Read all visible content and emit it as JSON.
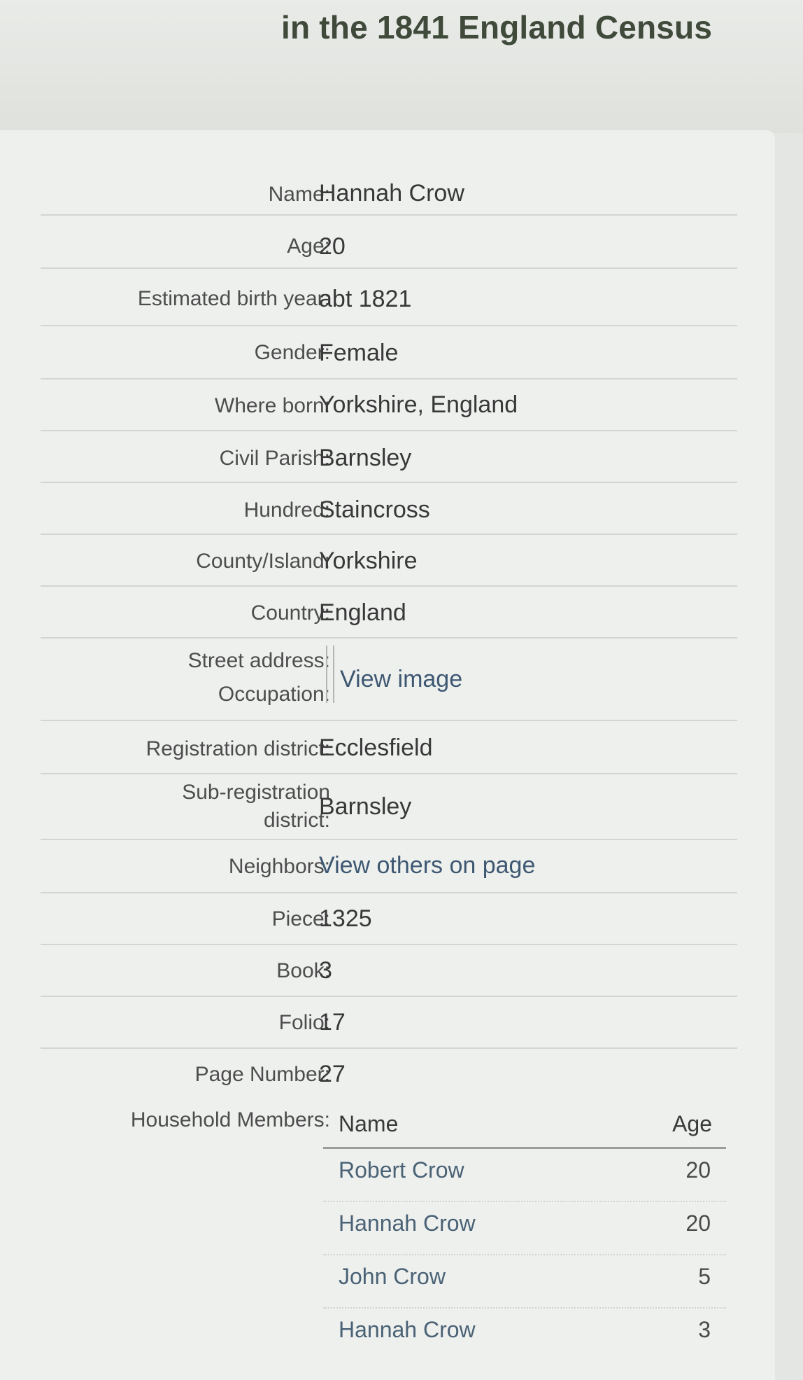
{
  "page": {
    "title": "in the 1841 England Census"
  },
  "details": [
    {
      "label": "Name:",
      "value": "Hannah Crow"
    },
    {
      "label": "Age:",
      "value": "20"
    },
    {
      "label": "Estimated birth year:",
      "value": "abt 1821"
    },
    {
      "label": "Gender:",
      "value": "Female"
    },
    {
      "label": "Where born:",
      "value": "Yorkshire, England"
    },
    {
      "label": "Civil Parish:",
      "value": "Barnsley"
    },
    {
      "label": "Hundred:",
      "value": "Staincross"
    },
    {
      "label": "County/Island:",
      "value": "Yorkshire"
    },
    {
      "label": "Country:",
      "value": "England"
    },
    {
      "label": "Street address:",
      "label2": "Occupation:",
      "value": "View image"
    },
    {
      "label": "Registration district:",
      "value": "Ecclesfield"
    },
    {
      "label": "Sub-registration",
      "label2": "district:",
      "value": "Barnsley"
    },
    {
      "label": "Neighbors:",
      "value": "View others on page"
    },
    {
      "label": "Piece:",
      "value": "1325"
    },
    {
      "label": "Book:",
      "value": "3"
    },
    {
      "label": "Folio:",
      "value": "17"
    },
    {
      "label": "Page Number:",
      "value": "27"
    }
  ],
  "household": {
    "label": "Household Members:",
    "headers": {
      "name": "Name",
      "age": "Age"
    },
    "members": [
      {
        "name": "Robert Crow",
        "age": "20"
      },
      {
        "name": "Hannah Crow",
        "age": "20"
      },
      {
        "name": "John Crow",
        "age": "5"
      },
      {
        "name": "Hannah Crow",
        "age": "3"
      }
    ]
  }
}
